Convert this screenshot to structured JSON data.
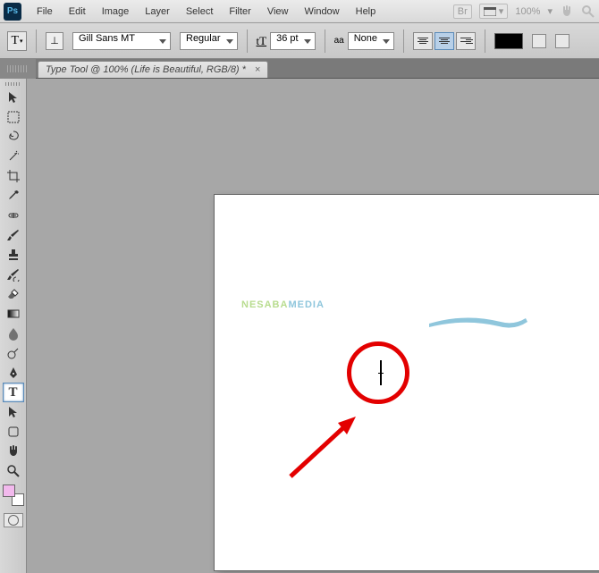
{
  "app": {
    "logo_text": "Ps"
  },
  "menu": {
    "items": [
      "File",
      "Edit",
      "Image",
      "Layer",
      "Select",
      "Filter",
      "View",
      "Window",
      "Help"
    ],
    "zoom": "100%"
  },
  "options": {
    "font_family": "Gill Sans MT",
    "font_style": "Regular",
    "font_size": "36 pt",
    "anti_alias": "None",
    "size_label": "tT",
    "aa_label": "aa"
  },
  "tab": {
    "title": "Type Tool @ 100% (Life is Beautiful, RGB/8) *",
    "close": "×"
  },
  "tools": [
    {
      "name": "move-tool"
    },
    {
      "name": "marquee-tool"
    },
    {
      "name": "lasso-tool"
    },
    {
      "name": "wand-tool"
    },
    {
      "name": "crop-tool"
    },
    {
      "name": "eyedropper-tool"
    },
    {
      "name": "healing-tool"
    },
    {
      "name": "brush-tool"
    },
    {
      "name": "stamp-tool"
    },
    {
      "name": "history-brush-tool"
    },
    {
      "name": "eraser-tool"
    },
    {
      "name": "gradient-tool"
    },
    {
      "name": "blur-tool"
    },
    {
      "name": "dodge-tool"
    },
    {
      "name": "pen-tool"
    },
    {
      "name": "type-tool"
    },
    {
      "name": "path-select-tool"
    },
    {
      "name": "shape-tool"
    },
    {
      "name": "hand-tool"
    },
    {
      "name": "zoom-tool"
    }
  ],
  "watermark": {
    "part1": "NESABA",
    "part2": "MEDIA"
  }
}
